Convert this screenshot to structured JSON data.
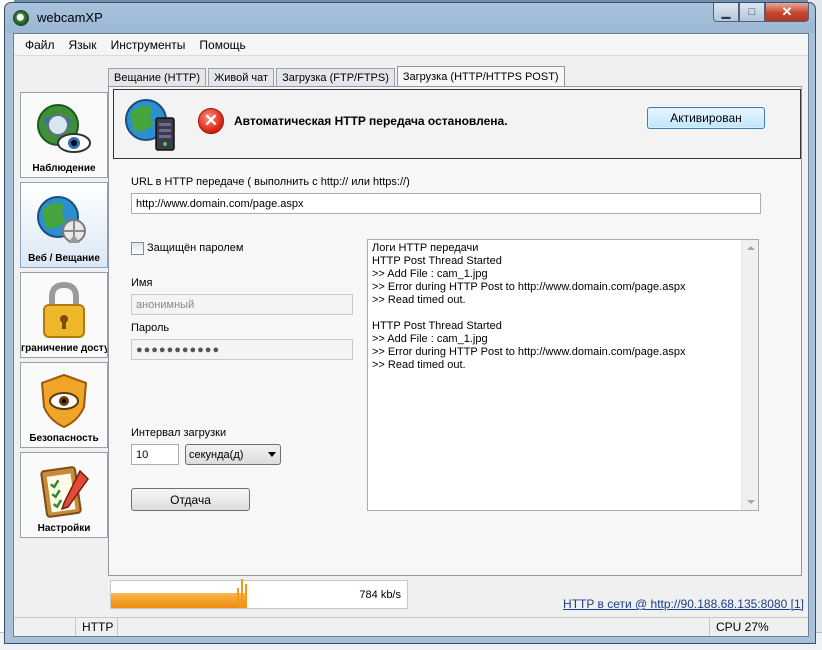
{
  "window": {
    "title": "webcamXP"
  },
  "menu": [
    "Файл",
    "Язык",
    "Инструменты",
    "Помощь"
  ],
  "nav": [
    {
      "label": "Наблюдение",
      "icon": "surveillance-globe-eye-icon"
    },
    {
      "label": "Веб / Вещание",
      "icon": "web-broadcast-globe-icon"
    },
    {
      "label": "граничение досту",
      "icon": "padlock-icon"
    },
    {
      "label": "Безопасность",
      "icon": "security-shield-eye-icon"
    },
    {
      "label": "Настройки",
      "icon": "settings-clipboard-icon"
    }
  ],
  "tabs": [
    "Вещание (HTTP)",
    "Живой чат",
    "Загрузка (FTP/FTPS)",
    "Загрузка (HTTP/HTTPS POST)"
  ],
  "status": {
    "message": "Автоматическая HTTP передача остановлена.",
    "button": "Активирован",
    "error_glyph": "✕"
  },
  "form": {
    "url_label": "URL в HTTP передаче ( выполнить с http:// или https://)",
    "url_value": "http://www.domain.com/page.aspx",
    "password_protected_label": "Защищён паролем",
    "name_label": "Имя",
    "name_placeholder": "анонимный",
    "password_label": "Пароль",
    "password_value": "●●●●●●●●●●●",
    "interval_label": "Интервал загрузки",
    "interval_value": "10",
    "interval_unit": "секунда(д)",
    "upload_button": "Отдача"
  },
  "log": {
    "lines": [
      "Логи HTTP передачи",
      "HTTP Post Thread Started",
      ">> Add File : cam_1.jpg",
      ">> Error during HTTP Post to http://www.domain.com/page.aspx",
      ">> Read timed out.",
      "",
      "HTTP Post Thread Started",
      ">> Add File : cam_1.jpg",
      ">> Error during HTTP Post to http://www.domain.com/page.aspx",
      ">> Read timed out."
    ]
  },
  "bandwidth": {
    "value": "784 kb/s"
  },
  "network_link": "HTTP в сети @ http://90.188.68.135:8080 [1]",
  "statusbar": {
    "protocol": "HTTP",
    "cpu": "CPU 27%"
  }
}
